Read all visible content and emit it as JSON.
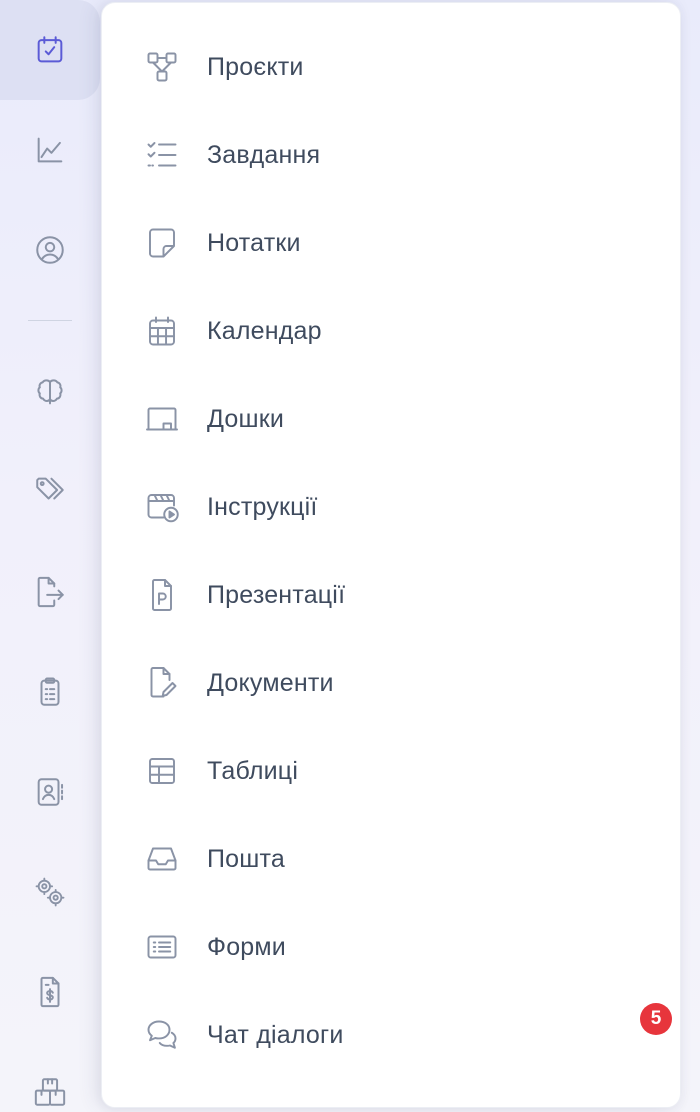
{
  "menu": {
    "items": [
      {
        "label": "Проєкти",
        "icon": "projects-icon"
      },
      {
        "label": "Завдання",
        "icon": "tasks-icon"
      },
      {
        "label": "Нотатки",
        "icon": "note-icon"
      },
      {
        "label": "Календар",
        "icon": "calendar-icon"
      },
      {
        "label": "Дошки",
        "icon": "board-icon"
      },
      {
        "label": "Інструкції",
        "icon": "video-instructions-icon"
      },
      {
        "label": "Презентації",
        "icon": "presentation-file-icon"
      },
      {
        "label": "Документи",
        "icon": "document-edit-icon"
      },
      {
        "label": "Таблиці",
        "icon": "table-icon"
      },
      {
        "label": "Пошта",
        "icon": "inbox-icon"
      },
      {
        "label": "Форми",
        "icon": "form-icon"
      },
      {
        "label": "Чат діалоги",
        "icon": "chat-icon"
      }
    ],
    "chat_badge": "5"
  },
  "rail": {
    "items": [
      "calendar-check-icon",
      "line-chart-icon",
      "user-circle-icon",
      "brain-icon",
      "tags-icon",
      "file-export-icon",
      "clipboard-list-icon",
      "contacts-book-icon",
      "gears-icon",
      "invoice-dollar-icon",
      "boxes-icon"
    ]
  },
  "colors": {
    "accent": "#5b5bd6",
    "icon_gray": "#8a93a6",
    "text": "#3f4b5e",
    "badge": "#e7353c",
    "active_rail_bg": "#dde0f3"
  }
}
